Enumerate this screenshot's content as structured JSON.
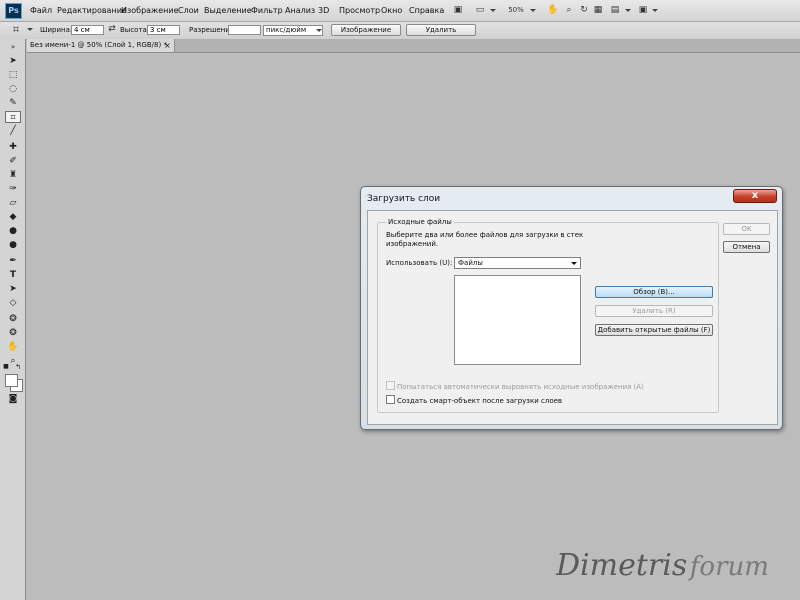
{
  "app": {
    "logo": "Ps",
    "menu": [
      "Файл",
      "Редактирование",
      "Изображение",
      "Слои",
      "Выделение",
      "Фильтр",
      "Анализ",
      "3D",
      "Просмотр",
      "Окно",
      "Справка"
    ],
    "zoom": "50%"
  },
  "options_bar": {
    "width_label": "Ширина:",
    "width_value": "4 см",
    "height_label": "Высота:",
    "height_value": "3 см",
    "resolution_label": "Разрешение:",
    "resolution_value": "",
    "resolution_unit": "пикс/дюйм",
    "image_button": "Изображение",
    "delete_button": "Удалить"
  },
  "document_tab": {
    "title": "Без имени-1 @ 50% (Слой 1, RGB/8) *",
    "close": "×"
  },
  "dialog": {
    "title": "Загрузить слои",
    "close": "x",
    "group_label": "Исходные файлы",
    "description": "Выберите два или более файлов для загрузки в стек изображений.",
    "use_label": "Использовать (U):",
    "use_value": "Файлы",
    "browse_button": "Обзор (B)...",
    "remove_button": "Удалить (R)",
    "add_open_button": "Добавить открытые файлы (F)",
    "align_checkbox": "Попытаться автоматически выровнять исходные изображения (A)",
    "smart_object_checkbox": "Создать смарт-объект после загрузки слоев",
    "ok_button": "OK",
    "cancel_button": "Отмена"
  },
  "watermark": {
    "part1": "Dimetris",
    "part2": "forum"
  }
}
